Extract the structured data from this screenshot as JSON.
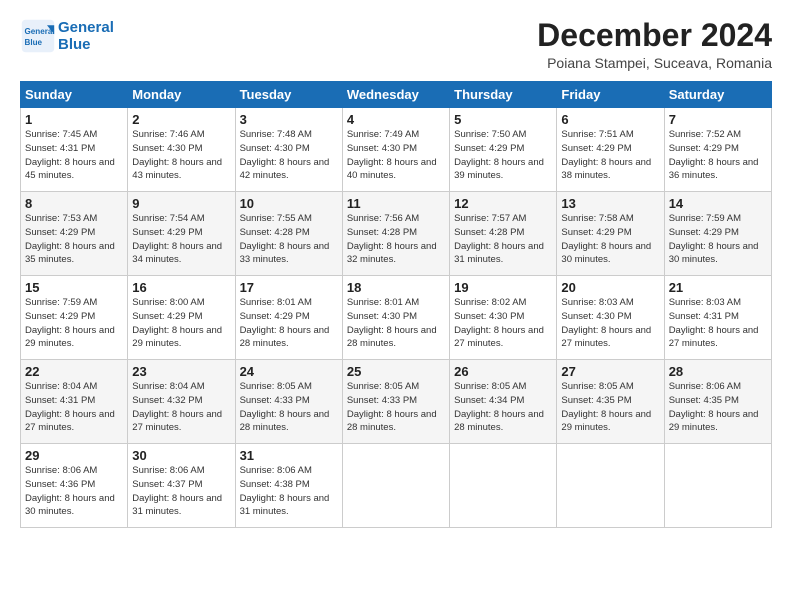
{
  "header": {
    "logo_line1": "General",
    "logo_line2": "Blue",
    "month_title": "December 2024",
    "location": "Poiana Stampei, Suceava, Romania"
  },
  "weekdays": [
    "Sunday",
    "Monday",
    "Tuesday",
    "Wednesday",
    "Thursday",
    "Friday",
    "Saturday"
  ],
  "weeks": [
    [
      {
        "day": "1",
        "sunrise": "7:45 AM",
        "sunset": "4:31 PM",
        "daylight": "8 hours and 45 minutes."
      },
      {
        "day": "2",
        "sunrise": "7:46 AM",
        "sunset": "4:30 PM",
        "daylight": "8 hours and 43 minutes."
      },
      {
        "day": "3",
        "sunrise": "7:48 AM",
        "sunset": "4:30 PM",
        "daylight": "8 hours and 42 minutes."
      },
      {
        "day": "4",
        "sunrise": "7:49 AM",
        "sunset": "4:30 PM",
        "daylight": "8 hours and 40 minutes."
      },
      {
        "day": "5",
        "sunrise": "7:50 AM",
        "sunset": "4:29 PM",
        "daylight": "8 hours and 39 minutes."
      },
      {
        "day": "6",
        "sunrise": "7:51 AM",
        "sunset": "4:29 PM",
        "daylight": "8 hours and 38 minutes."
      },
      {
        "day": "7",
        "sunrise": "7:52 AM",
        "sunset": "4:29 PM",
        "daylight": "8 hours and 36 minutes."
      }
    ],
    [
      {
        "day": "8",
        "sunrise": "7:53 AM",
        "sunset": "4:29 PM",
        "daylight": "8 hours and 35 minutes."
      },
      {
        "day": "9",
        "sunrise": "7:54 AM",
        "sunset": "4:29 PM",
        "daylight": "8 hours and 34 minutes."
      },
      {
        "day": "10",
        "sunrise": "7:55 AM",
        "sunset": "4:28 PM",
        "daylight": "8 hours and 33 minutes."
      },
      {
        "day": "11",
        "sunrise": "7:56 AM",
        "sunset": "4:28 PM",
        "daylight": "8 hours and 32 minutes."
      },
      {
        "day": "12",
        "sunrise": "7:57 AM",
        "sunset": "4:28 PM",
        "daylight": "8 hours and 31 minutes."
      },
      {
        "day": "13",
        "sunrise": "7:58 AM",
        "sunset": "4:29 PM",
        "daylight": "8 hours and 30 minutes."
      },
      {
        "day": "14",
        "sunrise": "7:59 AM",
        "sunset": "4:29 PM",
        "daylight": "8 hours and 30 minutes."
      }
    ],
    [
      {
        "day": "15",
        "sunrise": "7:59 AM",
        "sunset": "4:29 PM",
        "daylight": "8 hours and 29 minutes."
      },
      {
        "day": "16",
        "sunrise": "8:00 AM",
        "sunset": "4:29 PM",
        "daylight": "8 hours and 29 minutes."
      },
      {
        "day": "17",
        "sunrise": "8:01 AM",
        "sunset": "4:29 PM",
        "daylight": "8 hours and 28 minutes."
      },
      {
        "day": "18",
        "sunrise": "8:01 AM",
        "sunset": "4:30 PM",
        "daylight": "8 hours and 28 minutes."
      },
      {
        "day": "19",
        "sunrise": "8:02 AM",
        "sunset": "4:30 PM",
        "daylight": "8 hours and 27 minutes."
      },
      {
        "day": "20",
        "sunrise": "8:03 AM",
        "sunset": "4:30 PM",
        "daylight": "8 hours and 27 minutes."
      },
      {
        "day": "21",
        "sunrise": "8:03 AM",
        "sunset": "4:31 PM",
        "daylight": "8 hours and 27 minutes."
      }
    ],
    [
      {
        "day": "22",
        "sunrise": "8:04 AM",
        "sunset": "4:31 PM",
        "daylight": "8 hours and 27 minutes."
      },
      {
        "day": "23",
        "sunrise": "8:04 AM",
        "sunset": "4:32 PM",
        "daylight": "8 hours and 27 minutes."
      },
      {
        "day": "24",
        "sunrise": "8:05 AM",
        "sunset": "4:33 PM",
        "daylight": "8 hours and 28 minutes."
      },
      {
        "day": "25",
        "sunrise": "8:05 AM",
        "sunset": "4:33 PM",
        "daylight": "8 hours and 28 minutes."
      },
      {
        "day": "26",
        "sunrise": "8:05 AM",
        "sunset": "4:34 PM",
        "daylight": "8 hours and 28 minutes."
      },
      {
        "day": "27",
        "sunrise": "8:05 AM",
        "sunset": "4:35 PM",
        "daylight": "8 hours and 29 minutes."
      },
      {
        "day": "28",
        "sunrise": "8:06 AM",
        "sunset": "4:35 PM",
        "daylight": "8 hours and 29 minutes."
      }
    ],
    [
      {
        "day": "29",
        "sunrise": "8:06 AM",
        "sunset": "4:36 PM",
        "daylight": "8 hours and 30 minutes."
      },
      {
        "day": "30",
        "sunrise": "8:06 AM",
        "sunset": "4:37 PM",
        "daylight": "8 hours and 31 minutes."
      },
      {
        "day": "31",
        "sunrise": "8:06 AM",
        "sunset": "4:38 PM",
        "daylight": "8 hours and 31 minutes."
      },
      null,
      null,
      null,
      null
    ]
  ]
}
